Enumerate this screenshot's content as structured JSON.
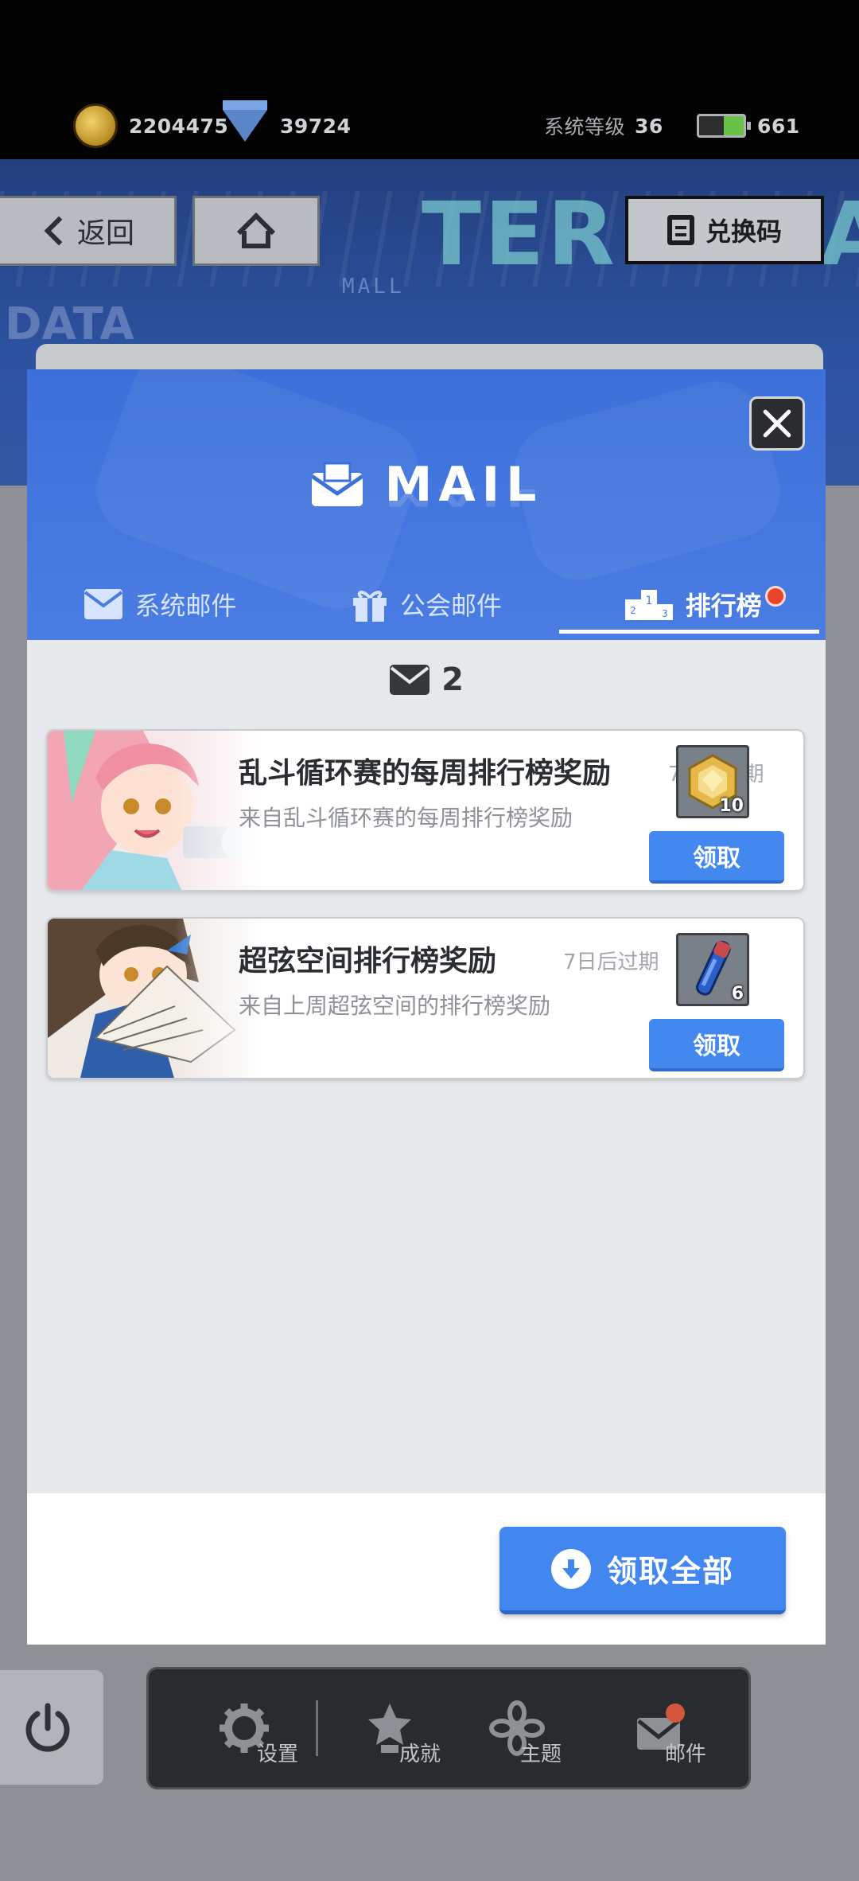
{
  "resources": {
    "gold": "2204475",
    "gems": "39724",
    "system_level_label": "系统等级",
    "system_level": "36",
    "energy": "661"
  },
  "background": {
    "back_label": "返回",
    "redeem_label": "兑换码",
    "banner_text": "TERMINAL",
    "banner_sub_text": "DATA",
    "banner_mall_text": "MALL"
  },
  "modal": {
    "title": "MAIL",
    "tabs": [
      {
        "label": "系统邮件",
        "icon": "envelope-icon"
      },
      {
        "label": "公会邮件",
        "icon": "gift-icon"
      },
      {
        "label": "排行榜",
        "icon": "podium-icon",
        "active": true,
        "has_notification": true
      }
    ],
    "mail_count": "2",
    "mails": [
      {
        "title": "乱斗循环赛的每周排行榜奖励",
        "expire": "7日后过期",
        "subtitle": "来自乱斗循环赛的每周排行榜奖励",
        "reward_qty": "10",
        "reward_icon": "gold-hexagon-token-icon",
        "claim_label": "领取"
      },
      {
        "title": "超弦空间排行榜奖励",
        "expire": "7日后过期",
        "subtitle": "来自上周超弦空间的排行榜奖励",
        "reward_qty": "6",
        "reward_icon": "blue-vial-icon",
        "claim_label": "领取"
      }
    ],
    "claim_all_label": "领取全部"
  },
  "bottom_nav": {
    "items": [
      {
        "label": "设置",
        "icon": "gear-icon"
      },
      {
        "label": "成就",
        "icon": "star-trophy-icon"
      },
      {
        "label": "主题",
        "icon": "flower-icon"
      },
      {
        "label": "邮件",
        "icon": "mail-icon",
        "has_notification": true
      }
    ]
  },
  "colors": {
    "accent_blue": "#4388ee",
    "header_blue": "#3c6fd9",
    "notification_red": "#e8442c"
  }
}
